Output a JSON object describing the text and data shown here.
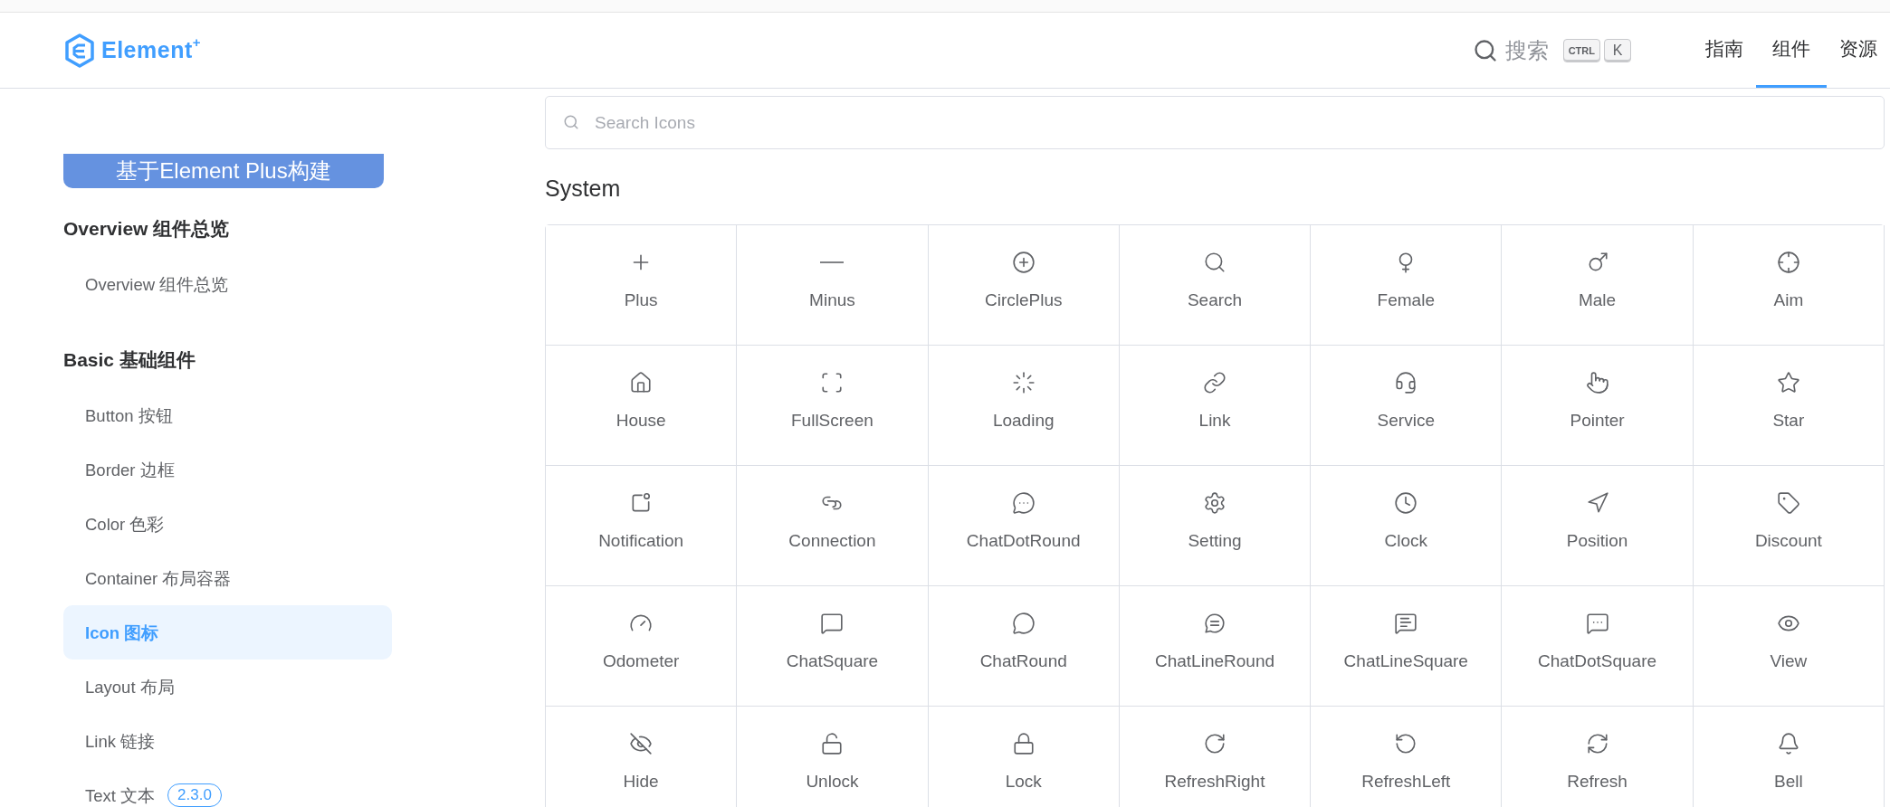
{
  "header": {
    "logo": "Element$^{+}$",
    "search": {
      "label": "搜索",
      "keys": [
        "CTRL",
        "K"
      ]
    },
    "nav": [
      {
        "label": "指南",
        "selected": false
      },
      {
        "label": "组件",
        "selected": true
      },
      {
        "label": "资源",
        "selected": false
      }
    ]
  },
  "sidebar": {
    "banner": "基于Element Plus构建",
    "groups": [
      {
        "title": "Overview 组件总览",
        "items": [
          {
            "label": "Overview 组件总览",
            "selected": false
          }
        ]
      },
      {
        "title": "Basic 基础组件",
        "items": [
          {
            "label": "Button 按钮",
            "selected": false
          },
          {
            "label": "Border 边框",
            "selected": false
          },
          {
            "label": "Color 色彩",
            "selected": false
          },
          {
            "label": "Container 布局容器",
            "selected": false
          },
          {
            "label": "Icon 图标",
            "selected": true
          },
          {
            "label": "Layout 布局",
            "selected": false
          },
          {
            "label": "Link 链接",
            "selected": false
          },
          {
            "label": "Text 文本",
            "badge": "2.3.0",
            "selected": false
          }
        ]
      }
    ]
  },
  "main": {
    "search": {
      "placeholder": "Search Icons"
    },
    "section": "System",
    "icons": [
      "Plus",
      "Minus",
      "CirclePlus",
      "Search",
      "Female",
      "Male",
      "Aim",
      "House",
      "FullScreen",
      "Loading",
      "Link",
      "Service",
      "Pointer",
      "Star",
      "Notification",
      "Connection",
      "ChatDotRound",
      "Setting",
      "Clock",
      "Position",
      "Discount",
      "Odometer",
      "ChatSquare",
      "ChatRound",
      "ChatLineRound",
      "ChatLineSquare",
      "ChatDotSquare",
      "View",
      "Hide",
      "Unlock",
      "Lock",
      "RefreshRight",
      "RefreshLeft",
      "Refresh",
      "Bell"
    ]
  }
}
